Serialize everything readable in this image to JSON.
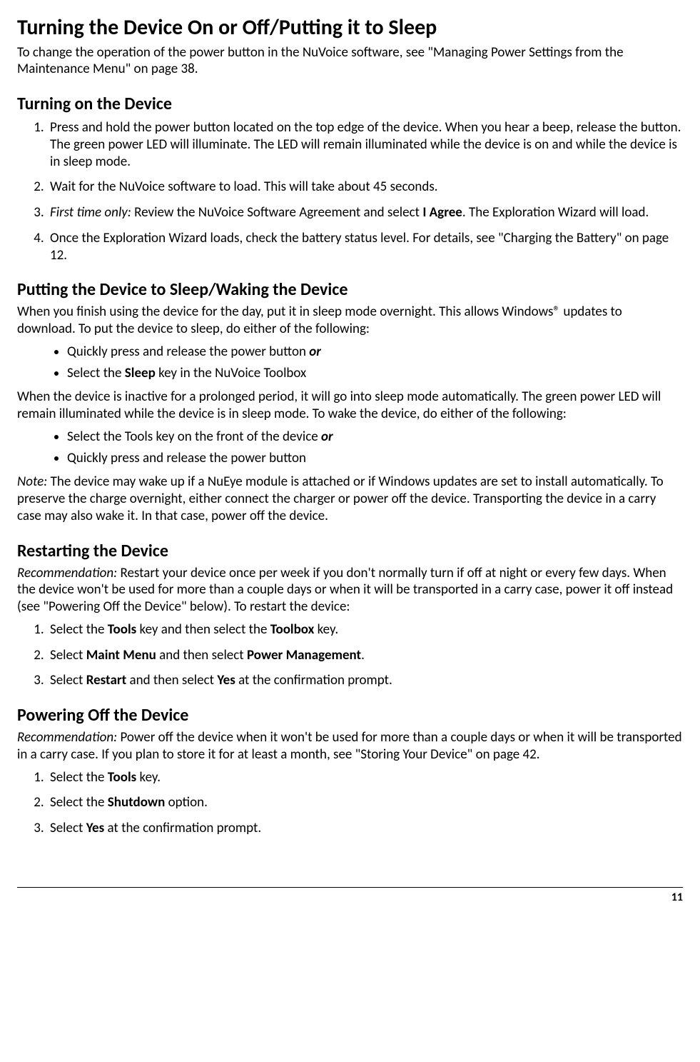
{
  "title": "Turning the Device On or Off/Putting it to Sleep",
  "intro": "To change the operation of the power button in the NuVoice software, see \"Managing Power Settings from the Maintenance Menu\" on page 38.",
  "section1": {
    "heading": "Turning on the Device",
    "items": {
      "i1": "Press and hold the power button located on the top edge of the device. When you hear a beep, release the button. The green power LED will illuminate. The LED will remain illuminated while the device is on and while the device is in sleep mode.",
      "i2": "Wait for the NuVoice software to load. This will take about 45 seconds.",
      "i3a": "First time only:",
      "i3b": " Review the NuVoice Software Agreement and select ",
      "i3c": "I Agree",
      "i3d": ". The Exploration Wizard will load.",
      "i4": "Once the Exploration Wizard loads, check the battery status level. For details, see \"Charging the Battery\" on page 12."
    }
  },
  "section2": {
    "heading": "Putting the Device to Sleep/Waking the Device",
    "p1": "When you finish using the device for the day, put it in sleep mode overnight. This allows Windows® updates to download. To put the device to sleep, do either of the following:",
    "b1a": "Quickly press and release the power button ",
    "b1b": "or",
    "b2a": "Select the ",
    "b2b": "Sleep",
    "b2c": " key in the NuVoice Toolbox",
    "p2": "When the device is inactive for a prolonged period, it will go into sleep mode automatically. The green power LED will remain illuminated while the device is in sleep mode. To wake the device, do either of the following:",
    "b3a": "Select the Tools key on the front of the device ",
    "b3b": "or",
    "b4": "Quickly press and release the power button",
    "note_a": "Note:",
    "note_b": " The device may wake up if a NuEye module is attached or if Windows updates are set to install automatically. To preserve the charge overnight, either connect the charger or power off the device. Transporting the device in a carry case may also wake it. In that case, power off the device."
  },
  "section3": {
    "heading": "Restarting the Device",
    "rec_a": "Recommendation:",
    "rec_b": " Restart your device once per week if you don't normally turn if off at night or every few days. When the device won't be used for more than a couple days or when it will be transported in a carry case, power it off instead (see \"Powering Off the Device\" below). To restart the device:",
    "i1a": "Select the ",
    "i1b": "Tools",
    "i1c": " key and then select the ",
    "i1d": "Toolbox",
    "i1e": " key.",
    "i2a": "Select ",
    "i2b": "Maint Menu",
    "i2c": " and then select ",
    "i2d": "Power Management",
    "i2e": ".",
    "i3a": "Select ",
    "i3b": "Restart",
    "i3c": " and then select ",
    "i3d": "Yes",
    "i3e": " at the confirmation prompt."
  },
  "section4": {
    "heading": "Powering Off the Device",
    "rec_a": "Recommendation:",
    "rec_b": " Power off the device when it won't be used for more than a couple days or when it will be transported in a carry case. If you plan to store it for at least a month, see \"Storing Your Device\" on page 42.",
    "i1a": "Select the ",
    "i1b": "Tools",
    "i1c": " key.",
    "i2a": "Select the ",
    "i2b": "Shutdown",
    "i2c": " option.",
    "i3a": "Select ",
    "i3b": "Yes",
    "i3c": " at the confirmation prompt."
  },
  "page_number": "11"
}
